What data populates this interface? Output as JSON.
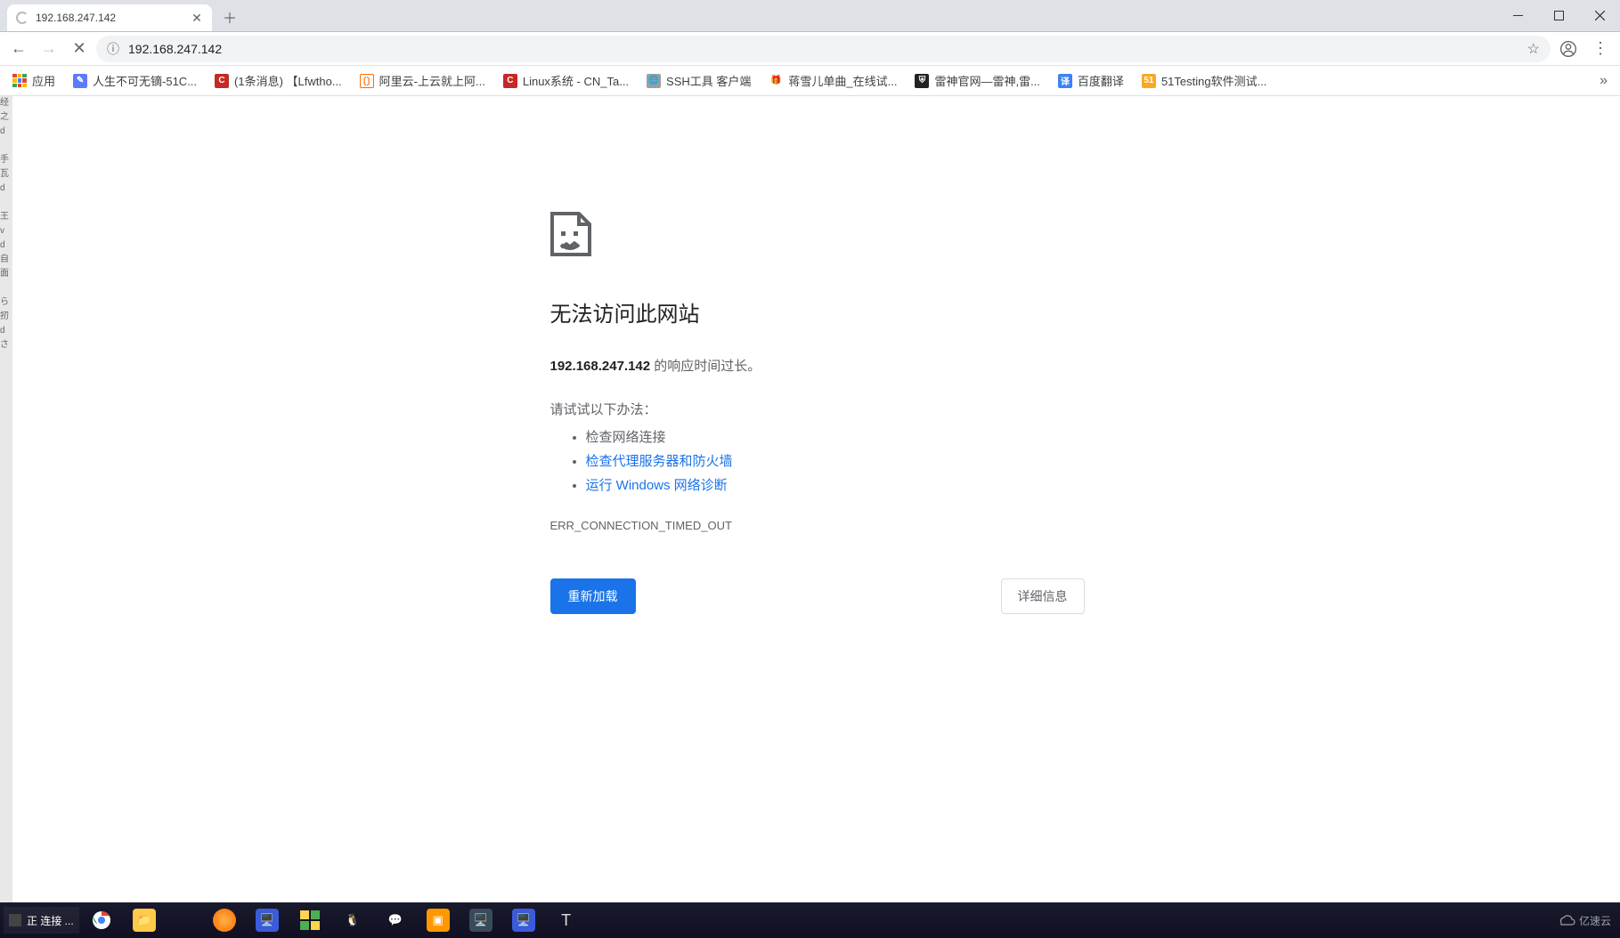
{
  "tab": {
    "title": "192.168.247.142"
  },
  "toolbar": {
    "url": "192.168.247.142"
  },
  "bookmarks": {
    "apps_label": "应用",
    "items": [
      {
        "label": "人生不可无镝-51C...",
        "bg": "#5b7cfa",
        "glyph": ""
      },
      {
        "label": "(1条消息) 【Lfwtho...",
        "bg": "#c62828",
        "glyph": "C"
      },
      {
        "label": "阿里云-上云就上阿...",
        "bg": "#ff6a00",
        "glyph": "〔〕"
      },
      {
        "label": "Linux系统 - CN_Ta...",
        "bg": "#c62828",
        "glyph": "C"
      },
      {
        "label": "SSH工具 客户端",
        "bg": "#808080",
        "glyph": "🌐"
      },
      {
        "label": "蒋雪儿单曲_在线试...",
        "bg": "#ffb300",
        "glyph": "🎵"
      },
      {
        "label": "雷神官网—雷神,雷...",
        "bg": "#222",
        "glyph": "⛨"
      },
      {
        "label": "百度翻译",
        "bg": "#3b82f6",
        "glyph": "译"
      },
      {
        "label": "51Testing软件测试...",
        "bg": "#f9a825",
        "glyph": "51"
      }
    ]
  },
  "error": {
    "heading": "无法访问此网站",
    "host": "192.168.247.142",
    "summary_suffix": " 的响应时间过长。",
    "try_label": "请试试以下办法：",
    "suggestions": {
      "s0": "检查网络连接",
      "s1": "检查代理服务器和防火墙",
      "s2": "运行 Windows 网络诊断"
    },
    "code": "ERR_CONNECTION_TIMED_OUT",
    "reload_label": "重新加载",
    "details_label": "详细信息"
  },
  "taskbar": {
    "pinned_label": "正 连接 ...",
    "watermark": "亿速云"
  }
}
